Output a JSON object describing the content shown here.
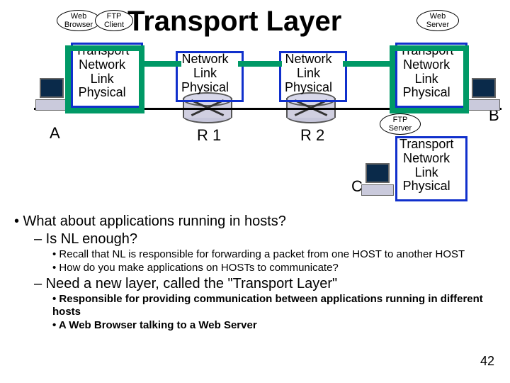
{
  "title": "Transport Layer",
  "apps": {
    "webBrowser": "Web\nBrowser",
    "ftpClient": "FTP\nClient",
    "webServer": "Web\nServer",
    "ftpServer": "FTP\nServer"
  },
  "stack4": {
    "l1": "Transport",
    "l2": "Network",
    "l3": "Link",
    "l4": "Physical"
  },
  "stack3": {
    "l1": "Network",
    "l2": "Link",
    "l3": "Physical"
  },
  "labels": {
    "A": "A",
    "B": "B",
    "C": "C",
    "R1": "R 1",
    "R2": "R 2"
  },
  "bullets": {
    "q1": "• What about applications running in hosts?",
    "q1a": "– Is NL enough?",
    "q1a1": "• Recall that NL is responsible for forwarding a packet from one HOST to another HOST",
    "q1a2": "• How do you make applications on HOSTs to communicate?",
    "q1b_pre": "– Need a new layer, called the ",
    "q1b_quote": "\"Transport Layer\"",
    "q1b1": "• Responsible for providing communication between applications running in different hosts",
    "q1b2": "• A Web Browser talking to a Web Server"
  },
  "page": "42"
}
